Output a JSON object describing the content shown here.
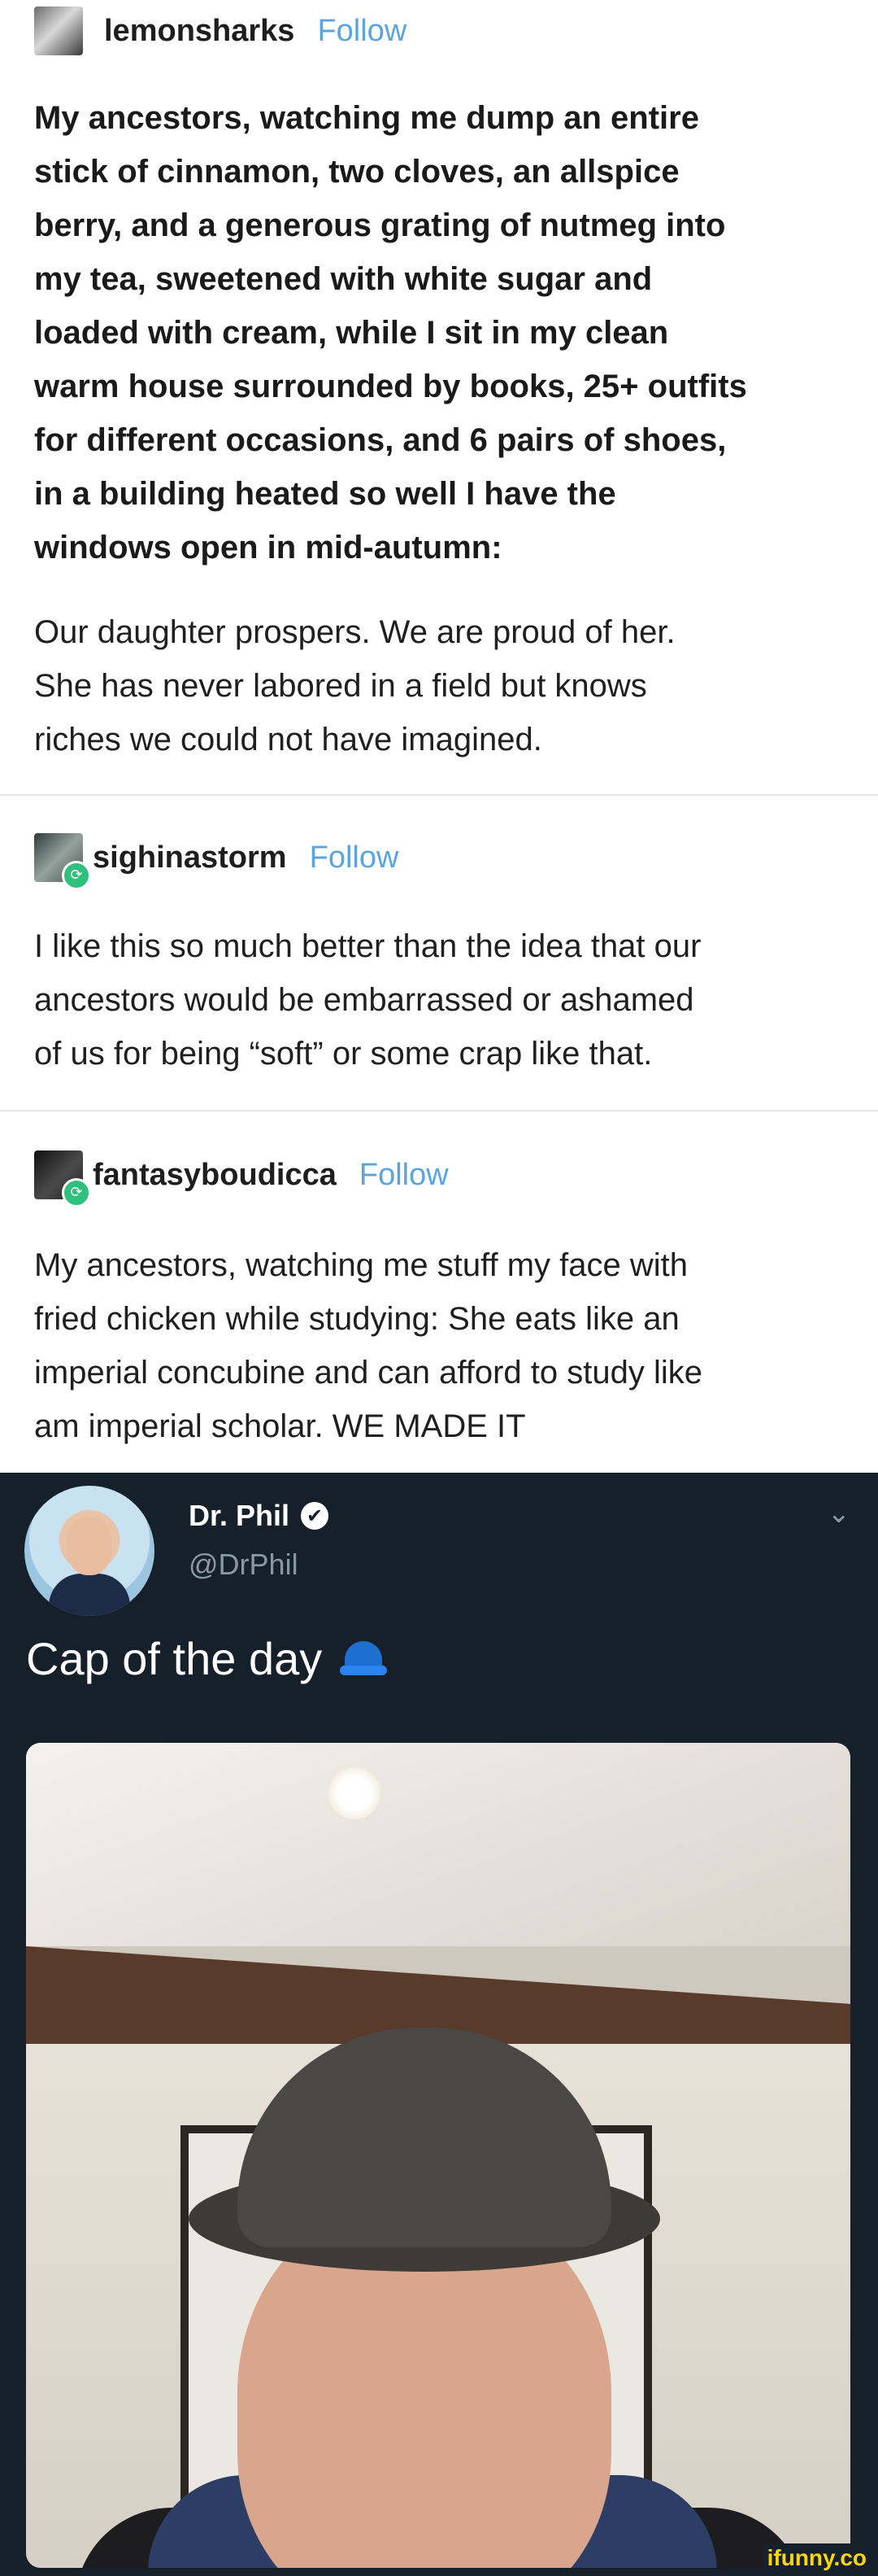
{
  "tumblr": {
    "post1": {
      "username": "lemonsharks",
      "follow_label": "Follow",
      "bold_lines": [
        "My ancestors, watching me dump an entire",
        "stick of cinnamon, two cloves, an allspice",
        "berry, and a generous grating of nutmeg into",
        "my tea, sweetened with white sugar and",
        "loaded with cream, while I sit in my clean",
        "warm house surrounded by books, 25+ outfits",
        "for different occasions, and 6 pairs of shoes,",
        "in a building heated so well I have the",
        "windows open in mid-autumn:"
      ],
      "body_lines": [
        "Our daughter prospers. We are proud of her.",
        "She has never labored in a field but knows",
        "riches we could not have imagined."
      ]
    },
    "post2": {
      "username": "sighinastorm",
      "follow_label": "Follow",
      "body_lines": [
        "I like this so much better than the idea that our",
        "ancestors would be embarrassed or ashamed",
        "of us for being “soft” or some crap like that."
      ]
    },
    "post3": {
      "username": "fantasyboudicca",
      "follow_label": "Follow",
      "body_lines": [
        "My ancestors, watching me stuff my face with",
        "fried chicken while studying: She eats like an",
        "imperial concubine and can afford to study like",
        "am imperial scholar. WE MADE IT"
      ]
    },
    "icons": {
      "reblog": "reblog-icon"
    }
  },
  "tweet": {
    "name": "Dr. Phil",
    "handle": "@DrPhil",
    "text": "Cap of the day",
    "verified_icon": "verified-badge-icon",
    "emoji": "billed-cap-emoji",
    "menu_icon": "chevron-down-icon"
  },
  "watermark": "ifunny.co",
  "colors": {
    "follow_blue": "#5aa4e0",
    "twitter_bg": "#15202b",
    "twitter_secondary": "#8899a6",
    "reblog_green": "#30c07d",
    "watermark_yellow": "#ffd60a"
  }
}
